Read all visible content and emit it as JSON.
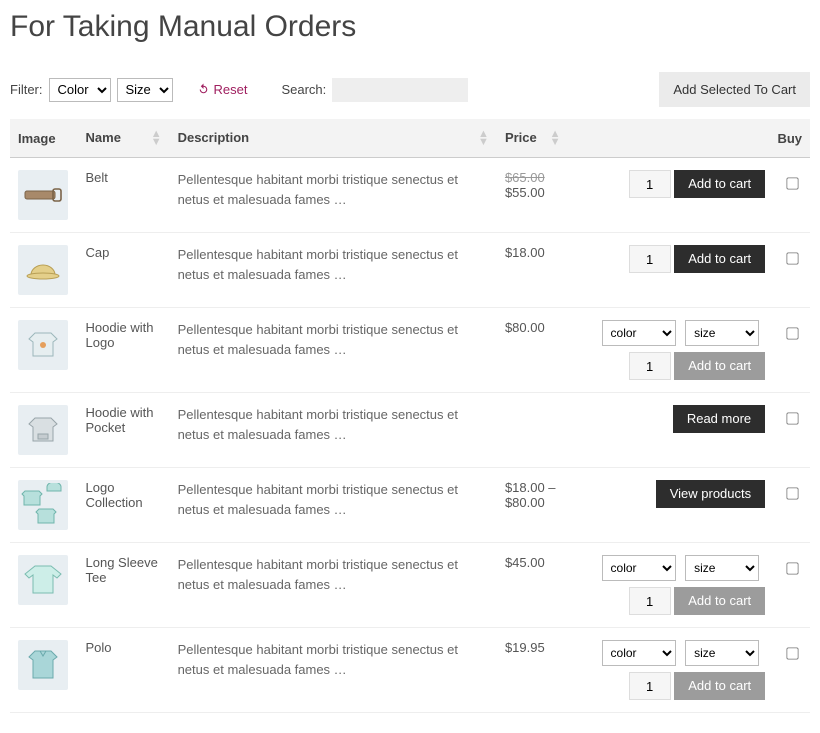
{
  "page": {
    "title": "For Taking Manual Orders"
  },
  "filters": {
    "label": "Filter:",
    "color": "Color",
    "size": "Size",
    "reset": "Reset",
    "search_label": "Search:",
    "add_selected": "Add Selected To Cart"
  },
  "columns": {
    "image": "Image",
    "name": "Name",
    "description": "Description",
    "price": "Price",
    "buy": "Buy"
  },
  "strings": {
    "add_to_cart": "Add to cart",
    "read_more": "Read more",
    "view_products": "View products",
    "opt_color": "color",
    "opt_size": "size",
    "default_qty": "1"
  },
  "products": [
    {
      "name": "Belt",
      "desc": "Pellentesque habitant morbi tristique senectus et netus et malesuada fames …",
      "old_price": "$65.00",
      "price": "$55.00",
      "icon": "belt",
      "mode": "simple"
    },
    {
      "name": "Cap",
      "desc": "Pellentesque habitant morbi tristique senectus et netus et malesuada fames …",
      "price": "$18.00",
      "icon": "cap",
      "mode": "simple"
    },
    {
      "name": "Hoodie with Logo",
      "desc": "Pellentesque habitant morbi tristique senectus et netus et malesuada fames …",
      "price": "$80.00",
      "icon": "hoodie-logo",
      "mode": "variant"
    },
    {
      "name": "Hoodie with Pocket",
      "desc": "Pellentesque habitant morbi tristique senectus et netus et malesuada fames …",
      "price": "",
      "icon": "hoodie-pocket",
      "mode": "readmore"
    },
    {
      "name": "Logo Collection",
      "desc": "Pellentesque habitant morbi tristique senectus et netus et malesuada fames …",
      "price": "$18.00 – $80.00",
      "icon": "collection",
      "mode": "viewproducts"
    },
    {
      "name": "Long Sleeve Tee",
      "desc": "Pellentesque habitant morbi tristique senectus et netus et malesuada fames …",
      "price": "$45.00",
      "icon": "longsleeve",
      "mode": "variant"
    },
    {
      "name": "Polo",
      "desc": "Pellentesque habitant morbi tristique senectus et netus et malesuada fames …",
      "price": "$19.95",
      "icon": "polo",
      "mode": "variant"
    }
  ]
}
